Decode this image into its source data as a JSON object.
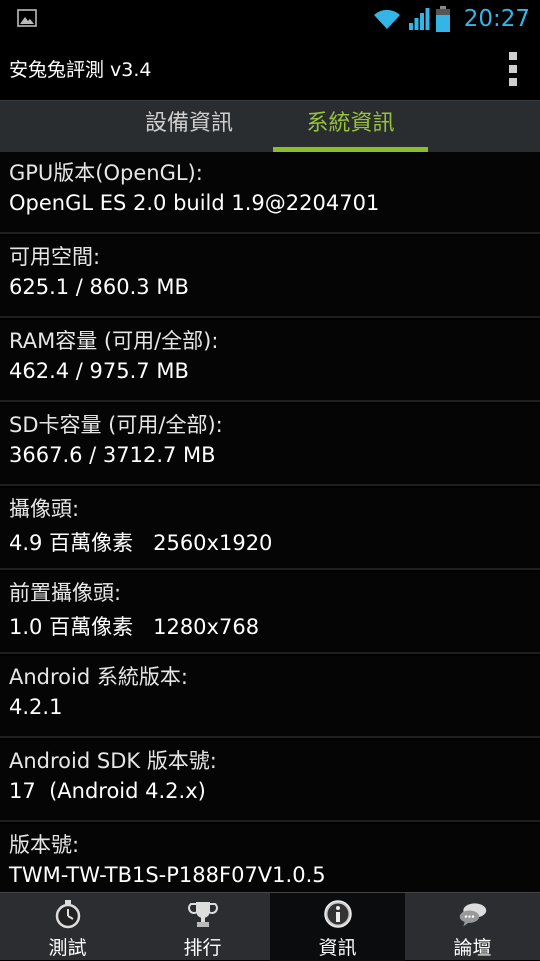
{
  "status_bar": {
    "time": "20:27",
    "icons": [
      "image-notification-icon",
      "wifi-icon",
      "signal-icon",
      "battery-icon"
    ],
    "time_color": "#33b5e5"
  },
  "action_bar": {
    "title": "安兔兔評測 v3.4",
    "overflow_icon": "overflow-menu-icon"
  },
  "tabs": [
    {
      "label": "設備資訊",
      "active": false
    },
    {
      "label": "系統資訊",
      "active": true
    }
  ],
  "accent_color": "#8cbd2a",
  "items": [
    {
      "label": "GPU版本(OpenGL):",
      "value": "OpenGL ES 2.0 build 1.9@2204701"
    },
    {
      "label": "可用空間:",
      "value": "625.1 / 860.3 MB"
    },
    {
      "label": "RAM容量 (可用/全部):",
      "value": "462.4 / 975.7 MB"
    },
    {
      "label": "SD卡容量 (可用/全部):",
      "value": "3667.6 / 3712.7 MB"
    },
    {
      "label": "攝像頭:",
      "value": "4.9 百萬像素   2560x1920"
    },
    {
      "label": "前置攝像頭:",
      "value": "1.0 百萬像素   1280x768"
    },
    {
      "label": "Android 系統版本:",
      "value": "4.2.1"
    },
    {
      "label": "Android SDK 版本號:",
      "value": "17  (Android 4.2.x)"
    },
    {
      "label": "版本號:",
      "value": "TWM-TW-TB1S-P188F07V1.0.5"
    }
  ],
  "bottom_nav": [
    {
      "label": "測試",
      "icon": "stopwatch-icon",
      "active": false
    },
    {
      "label": "排行",
      "icon": "trophy-icon",
      "active": false
    },
    {
      "label": "資訊",
      "icon": "info-icon",
      "active": true
    },
    {
      "label": "論壇",
      "icon": "chat-bubbles-icon",
      "active": false
    }
  ]
}
